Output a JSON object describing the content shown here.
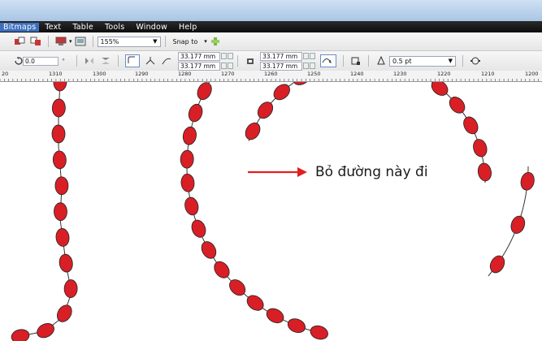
{
  "menu": {
    "items": [
      "Bitmaps",
      "Text",
      "Table",
      "Tools",
      "Window",
      "Help"
    ]
  },
  "toolbar": {
    "zoom_value": "155%",
    "snap_label": "Snap to"
  },
  "property_bar": {
    "rotation_value": "0.0",
    "rotation_unit": "°",
    "size_width": "33.177 mm",
    "size_height": "33.177 mm",
    "size2_width": "33.177 mm",
    "size2_height": "33.177 mm",
    "outline_width": "0.5 pt"
  },
  "ruler": {
    "ticks": [
      "20",
      "1310",
      "1300",
      "1290",
      "1280",
      "1270",
      "1260",
      "1250",
      "1240",
      "1230",
      "1220",
      "1210",
      "1200"
    ]
  },
  "annotation": {
    "text": "Bỏ đường này đi"
  },
  "colors": {
    "bead_fill": "#d81f26",
    "arrow": "#e02020",
    "menubar_bg": "#141414"
  }
}
